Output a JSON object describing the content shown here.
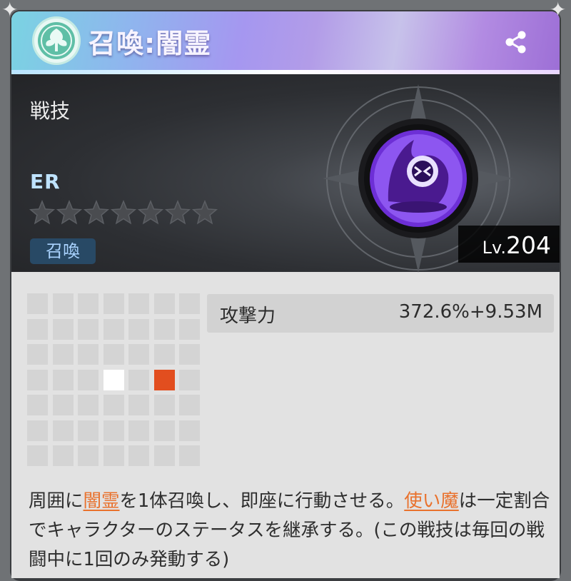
{
  "header": {
    "title": "召喚:闇霊",
    "share_icon": "share-icon",
    "emblem_icon": "tree-emblem-icon"
  },
  "skill": {
    "type_label": "戦技",
    "rarity": "ER",
    "star_rating": 0,
    "star_max": 7,
    "tag": "召喚",
    "level_prefix": "Lv.",
    "level": "204",
    "icon": "dark-spirit-icon"
  },
  "range_grid": {
    "rows": 7,
    "cols": 7,
    "origin_cell": [
      3,
      3
    ],
    "target_cells": [
      [
        3,
        5
      ]
    ],
    "colors": {
      "empty": "#d4d4d4",
      "origin": "#ffffff",
      "target": "#e24e1f"
    }
  },
  "stat": {
    "name": "攻撃力",
    "value": "372.6%+9.53M"
  },
  "description": {
    "p1": "周囲に",
    "link1": "闇霊",
    "p2": "を1体召喚し、即座に行動させる。",
    "link2": "使い魔",
    "p3": "は一定割合でキャラクターのステータスを継承する。(この戦技は毎回の戦闘中に1回のみ発動する)"
  },
  "colors": {
    "accent_orange": "#e9712c",
    "tag_bg": "#284965",
    "tag_text": "#aad3ff",
    "rarity_text": "#bfe3ff"
  }
}
